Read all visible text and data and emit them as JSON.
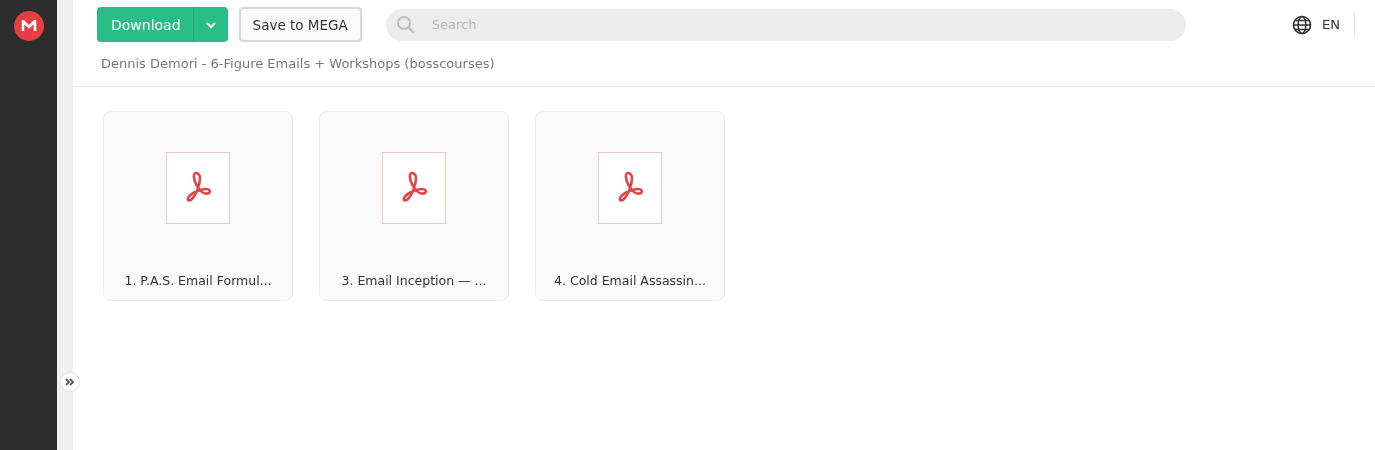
{
  "header": {
    "download_button": "Download",
    "save_button": "Save to MEGA",
    "search": {
      "placeholder": "Search"
    },
    "language": "EN"
  },
  "breadcrumb": "Dennis Demori - 6-Figure Emails + Workshops (bosscourses)",
  "files": [
    {
      "name": "1. P.A.S. Email Formul...",
      "kind": "pdf"
    },
    {
      "name": "3. Email Inception — ...",
      "kind": "pdf"
    },
    {
      "name": "4. Cold Email Assassin...",
      "kind": "pdf"
    }
  ]
}
